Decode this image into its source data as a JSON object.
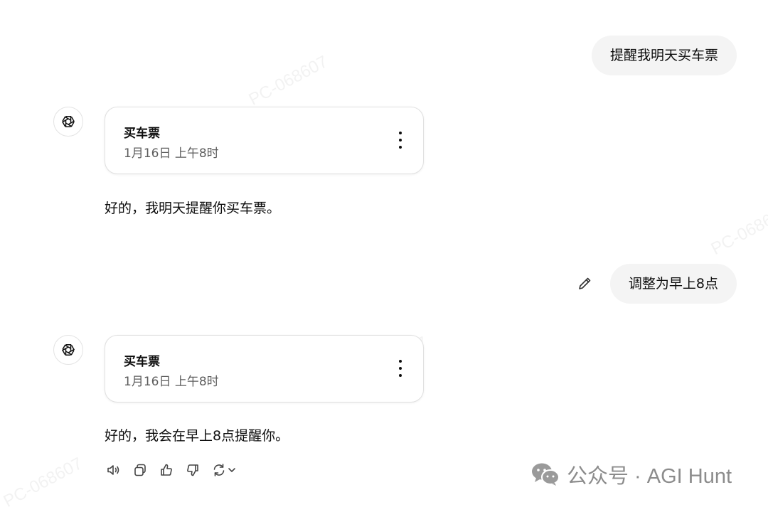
{
  "conversation": {
    "user_message_1": "提醒我明天买车票",
    "reminder_1": {
      "title": "买车票",
      "time": "1月16日 上午8时"
    },
    "reply_1": "好的，我明天提醒你买车票。",
    "user_message_2": "调整为早上8点",
    "reminder_2": {
      "title": "买车票",
      "time": "1月16日 上午8时"
    },
    "reply_2": "好的，我会在早上8点提醒你。"
  },
  "icons": {
    "assistant_avatar": "chatgpt-logo-icon",
    "edit": "pencil-icon",
    "card_menu": "more-vertical-icon",
    "actions": [
      "speaker-icon",
      "copy-icon",
      "thumbs-up-icon",
      "thumbs-down-icon",
      "regenerate-icon",
      "chevron-down-icon"
    ],
    "brand": "wechat-icon"
  },
  "watermark": {
    "text": "PC-068607"
  },
  "brand": {
    "label": "公众号 · AGI Hunt"
  }
}
